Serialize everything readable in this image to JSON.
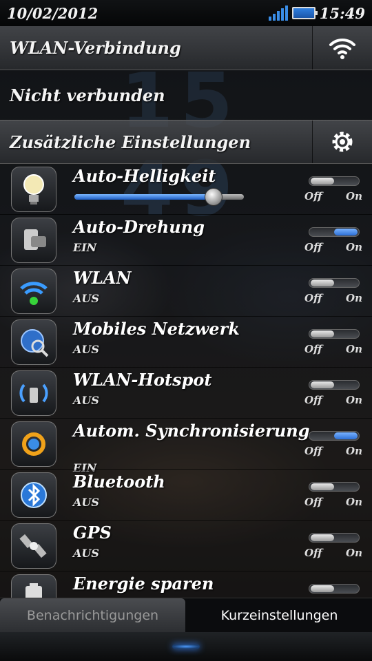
{
  "status_bar": {
    "date": "10/02/2012",
    "time": "15:49"
  },
  "header": {
    "wlan_title": "WLAN-Verbindung",
    "wlan_status": "Nicht verbunden",
    "extra_settings": "Zusätzliche Einstellungen"
  },
  "toggle_labels": {
    "off": "Off",
    "on": "On"
  },
  "brightness": {
    "label": "Auto-Helligkeit",
    "level": 0.82,
    "auto": false
  },
  "items": [
    {
      "label": "Auto-Drehung",
      "status": "EIN",
      "on": true,
      "icon": "rotation-icon"
    },
    {
      "label": "WLAN",
      "status": "AUS",
      "on": false,
      "icon": "wifi-icon"
    },
    {
      "label": "Mobiles Netzwerk",
      "status": "AUS",
      "on": false,
      "icon": "globe-icon"
    },
    {
      "label": "WLAN-Hotspot",
      "status": "AUS",
      "on": false,
      "icon": "hotspot-icon"
    },
    {
      "label": "Autom. Synchronisierung",
      "status": "EIN",
      "on": true,
      "icon": "sync-icon"
    },
    {
      "label": "Bluetooth",
      "status": "AUS",
      "on": false,
      "icon": "bluetooth-icon"
    },
    {
      "label": "GPS",
      "status": "AUS",
      "on": false,
      "icon": "satellite-icon"
    },
    {
      "label": "Energie sparen",
      "status": "",
      "on": false,
      "icon": "battery-icon"
    }
  ],
  "tabs": {
    "notifications": "Benachrichtigungen",
    "quick_settings": "Kurzeinstellungen"
  }
}
